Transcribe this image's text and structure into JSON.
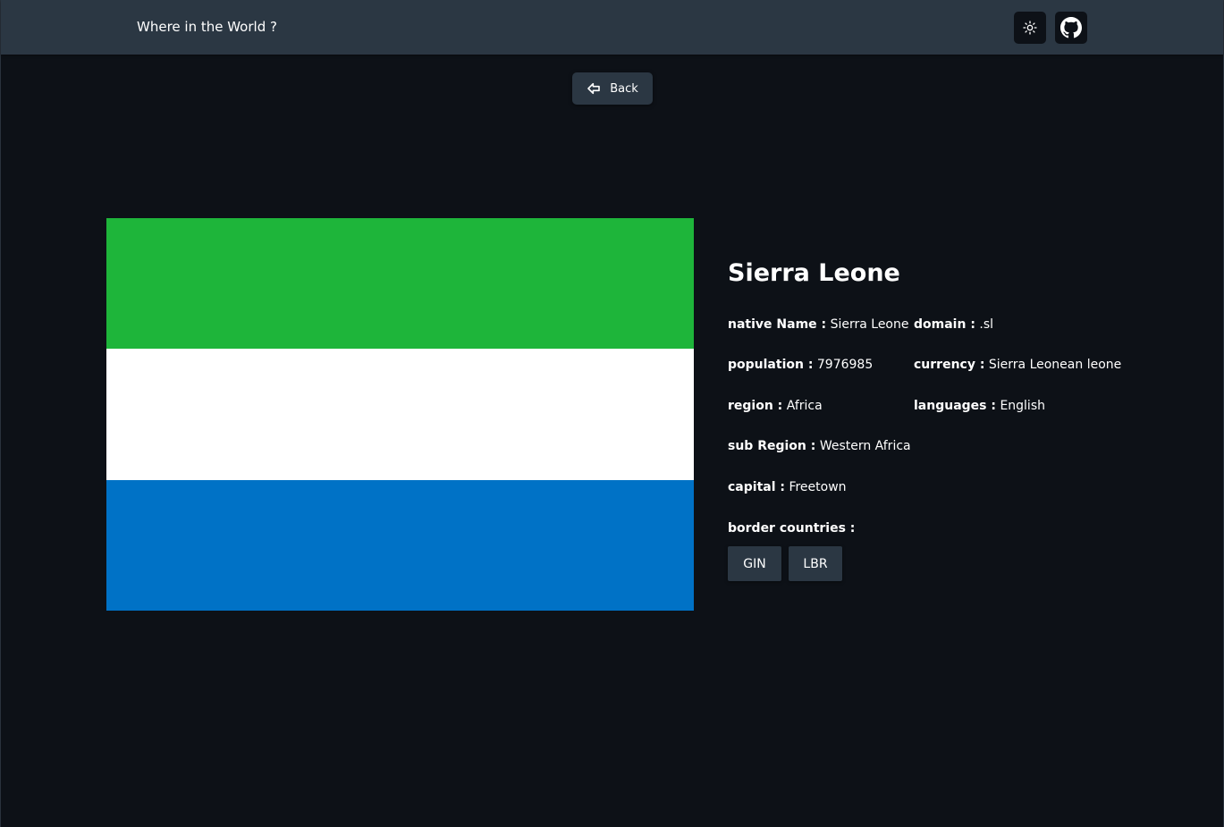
{
  "header": {
    "title": "Where in the World ?",
    "theme_icon": "sun-icon",
    "github_icon": "github-icon"
  },
  "back_button": {
    "label": "Back",
    "icon": "arrow-left-icon"
  },
  "flag": {
    "stripes": [
      "#1eb53a",
      "#ffffff",
      "#0072c6"
    ]
  },
  "country": {
    "name": "Sierra Leone",
    "native_name_label": "native Name :",
    "native_name": "Sierra Leone",
    "population_label": "population :",
    "population": "7976985",
    "region_label": "region :",
    "region": "Africa",
    "sub_region_label": "sub Region :",
    "sub_region": "Western Africa",
    "capital_label": "capital :",
    "capital": "Freetown",
    "domain_label": "domain :",
    "domain": ".sl",
    "currency_label": "currency :",
    "currency": "Sierra Leonean leone",
    "languages_label": "languages :",
    "languages": "English",
    "border_label": "border countries :",
    "borders": [
      "GIN",
      "LBR"
    ]
  },
  "colors": {
    "background": "#0d1117",
    "element": "#2b3743",
    "text": "#ffffff"
  }
}
